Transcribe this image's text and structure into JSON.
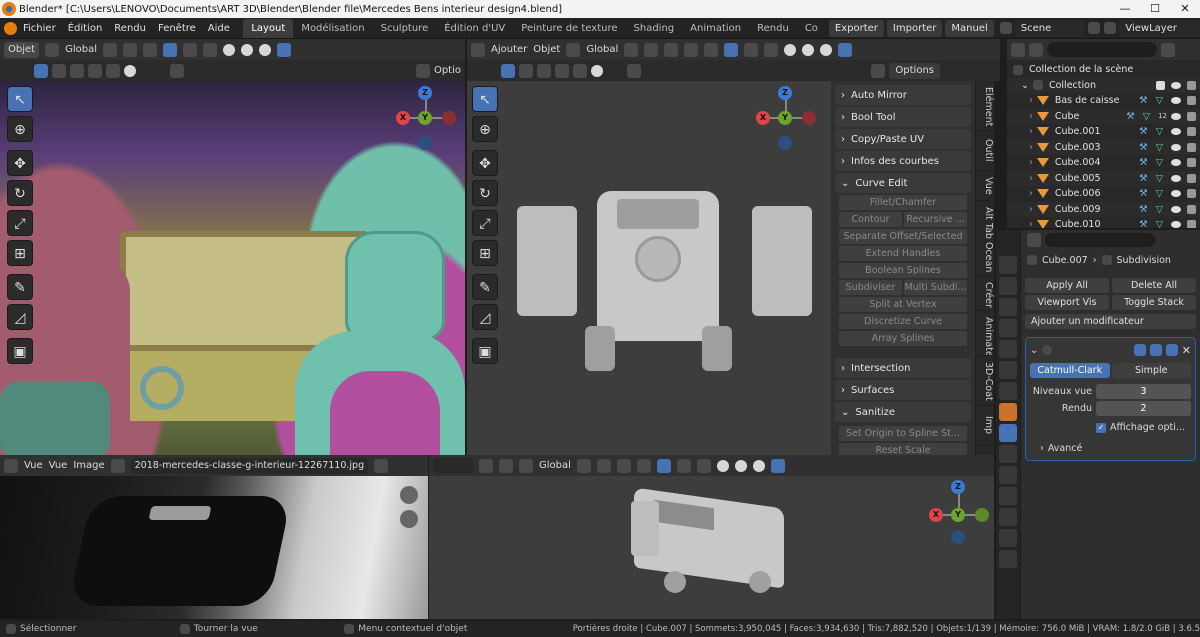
{
  "window": {
    "title": "Blender* [C:\\Users\\LENOVO\\Documents\\ART 3D\\Blender\\Blender file\\Mercedes Bens interieur design4.blend]",
    "minimize": "—",
    "maximize": "☐",
    "close": "✕"
  },
  "menu": [
    "Fichier",
    "Édition",
    "Rendu",
    "Fenêtre",
    "Aide"
  ],
  "workspaces": [
    "Layout",
    "Modélisation",
    "Sculpture",
    "Édition d'UV",
    "Peinture de texture",
    "Shading",
    "Animation",
    "Rendu",
    "Co"
  ],
  "topbar": {
    "export": "Exporter",
    "import": "Importer",
    "manual": "Manuel",
    "scene": "Scene",
    "viewlayer": "ViewLayer"
  },
  "left_view": {
    "mode": "Objet",
    "orientation": "Global",
    "options": "Optio"
  },
  "center_view": {
    "add": "Ajouter",
    "object": "Objet",
    "orientation": "Global",
    "options": "Options"
  },
  "gizmo": {
    "x": "X",
    "y": "Y",
    "z": "Z"
  },
  "npanel": {
    "sections": [
      "Auto Mirror",
      "Bool Tool",
      "Copy/Paste UV",
      "Infos des courbes",
      "Curve Edit"
    ],
    "curve_edit_buttons": [
      "Fillet/Chamfer",
      "Contour",
      "Recursive ...",
      "Separate Offset/Selected",
      "Extend Handles",
      "Boolean Splines",
      "Subdiviser",
      "Multi Subdi...",
      "Split at Vertex",
      "Discretize Curve",
      "Array Splines"
    ],
    "more_sections": [
      "Intersection",
      "Surfaces",
      "Sanitize"
    ],
    "sanitize_buttons": [
      "Set Origin to Spline St...",
      "Reset Scale"
    ],
    "tabs": [
      "Élément",
      "Outil",
      "Vue",
      "Alt Tab Ocean",
      "Créer",
      "Animate",
      "3D-Coat",
      "Imp"
    ]
  },
  "outliner": {
    "collection_root": "Collection de la scène",
    "collection": "Collection",
    "items": [
      "Bas de caisse",
      "Cube",
      "Cube.001",
      "Cube.003",
      "Cube.004",
      "Cube.005",
      "Cube.006",
      "Cube.009",
      "Cube.010"
    ],
    "badge": "12"
  },
  "properties": {
    "object": "Cube.007",
    "modifier": "Subdivision",
    "apply_all": "Apply All",
    "delete_all": "Delete All",
    "viewport_vis": "Viewport Vis",
    "toggle_stack": "Toggle Stack",
    "add_modifier": "Ajouter un modificateur",
    "catmull": "Catmull-Clark",
    "simple": "Simple",
    "levels_label": "Niveaux vue",
    "levels_value": "3",
    "render_label": "Rendu",
    "render_value": "2",
    "optimal": "Affichage opti...",
    "advanced": "Avancé"
  },
  "image_editor": {
    "view1": "Vue",
    "view2": "Vue",
    "image": "Image",
    "filename": "2018-mercedes-classe-g-interieur-12267110.jpg"
  },
  "bottom_view": {
    "orientation": "Global"
  },
  "status": {
    "select": "Sélectionner",
    "rotate": "Tourner la vue",
    "context": "Menu contextuel d'objet",
    "info": "Portières droite | Cube.007 | Sommets:3,950,045 | Faces:3,934,630 | Tris:7,882,520 | Objets:1/139 | Mémoire: 756.0 MiB | VRAM: 1.8/2.0 GiB | 3.6.5"
  },
  "colors": {
    "accent": "#4772b3",
    "gizmo_x": "#e0444b",
    "gizmo_y": "#6ca52c",
    "gizmo_z": "#3a7bd4"
  }
}
